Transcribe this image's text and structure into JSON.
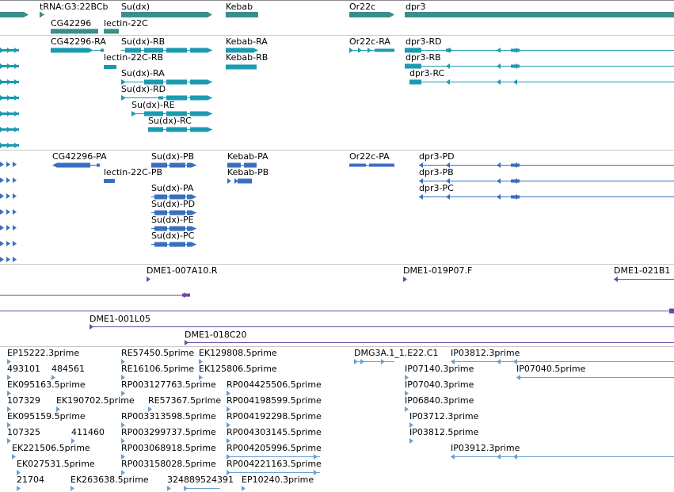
{
  "colors": {
    "gene": "#3a8f8a",
    "transcript_a": "#1c9ab0",
    "transcript_b": "#3a6fc0",
    "clone": "#6a4aa0",
    "est": "#6aa0d0"
  },
  "gene_labels": [
    "tRNA:G3:22BCb",
    "Su(dx)",
    "Kebab",
    "Or22c",
    "dpr3",
    "CG42296",
    "lectin-22C"
  ],
  "transcripts_a": [
    "CG42296-RA",
    "Su(dx)-RB",
    "Kebab-RA",
    "Or22c-RA",
    "dpr3-RD",
    "lectin-22C-RB",
    "Kebab-RB",
    "dpr3-RB",
    "Su(dx)-RA",
    "dpr3-RC",
    "Su(dx)-RD",
    "Su(dx)-RE",
    "Su(dx)-RC"
  ],
  "transcripts_b": [
    "CG42296-PA",
    "Su(dx)-PB",
    "Kebab-PA",
    "Or22c-PA",
    "dpr3-PD",
    "lectin-22C-PB",
    "Kebab-PB",
    "dpr3-PB",
    "dpr3-PC",
    "Su(dx)-PA",
    "Su(dx)-PD",
    "Su(dx)-PE",
    "Su(dx)-PC"
  ],
  "clones": [
    "DME1-007A10.R",
    "DME1-019P07.F",
    "DME1-021B1",
    "DME1-001L05",
    "DME1-018C20"
  ],
  "ests": [
    "EP15222.3prime",
    "RE57450.5prime",
    "EK129808.5prime",
    "DMG3A.1_1.E22.C1",
    "IP03812.3prime",
    "493101",
    "484561",
    "RE16106.5prime",
    "EK125806.5prime",
    "IP07140.3prime",
    "IP07040.5prime",
    "EK095163.5prime",
    "RP003127763.5prime",
    "RP004425506.5prime",
    "IP07040.3prime",
    "107329",
    "EK190702.5prime",
    "RE57367.5prime",
    "RP004198599.5prime",
    "IP06840.3prime",
    "EK095159.5prime",
    "RP003313598.5prime",
    "RP004192298.5prime",
    "IP03712.3prime",
    "107325",
    "411460",
    "RP003299737.5prime",
    "RP004303145.5prime",
    "IP03812.5prime",
    "EK221506.5prime",
    "RP003068918.5prime",
    "RP004205996.5prime",
    "IP03912.3prime",
    "EK027531.5prime",
    "RP003158028.5prime",
    "RP004221163.5prime",
    "21704",
    "EK263638.5prime",
    "324889524391",
    "EP10240.3prime"
  ]
}
